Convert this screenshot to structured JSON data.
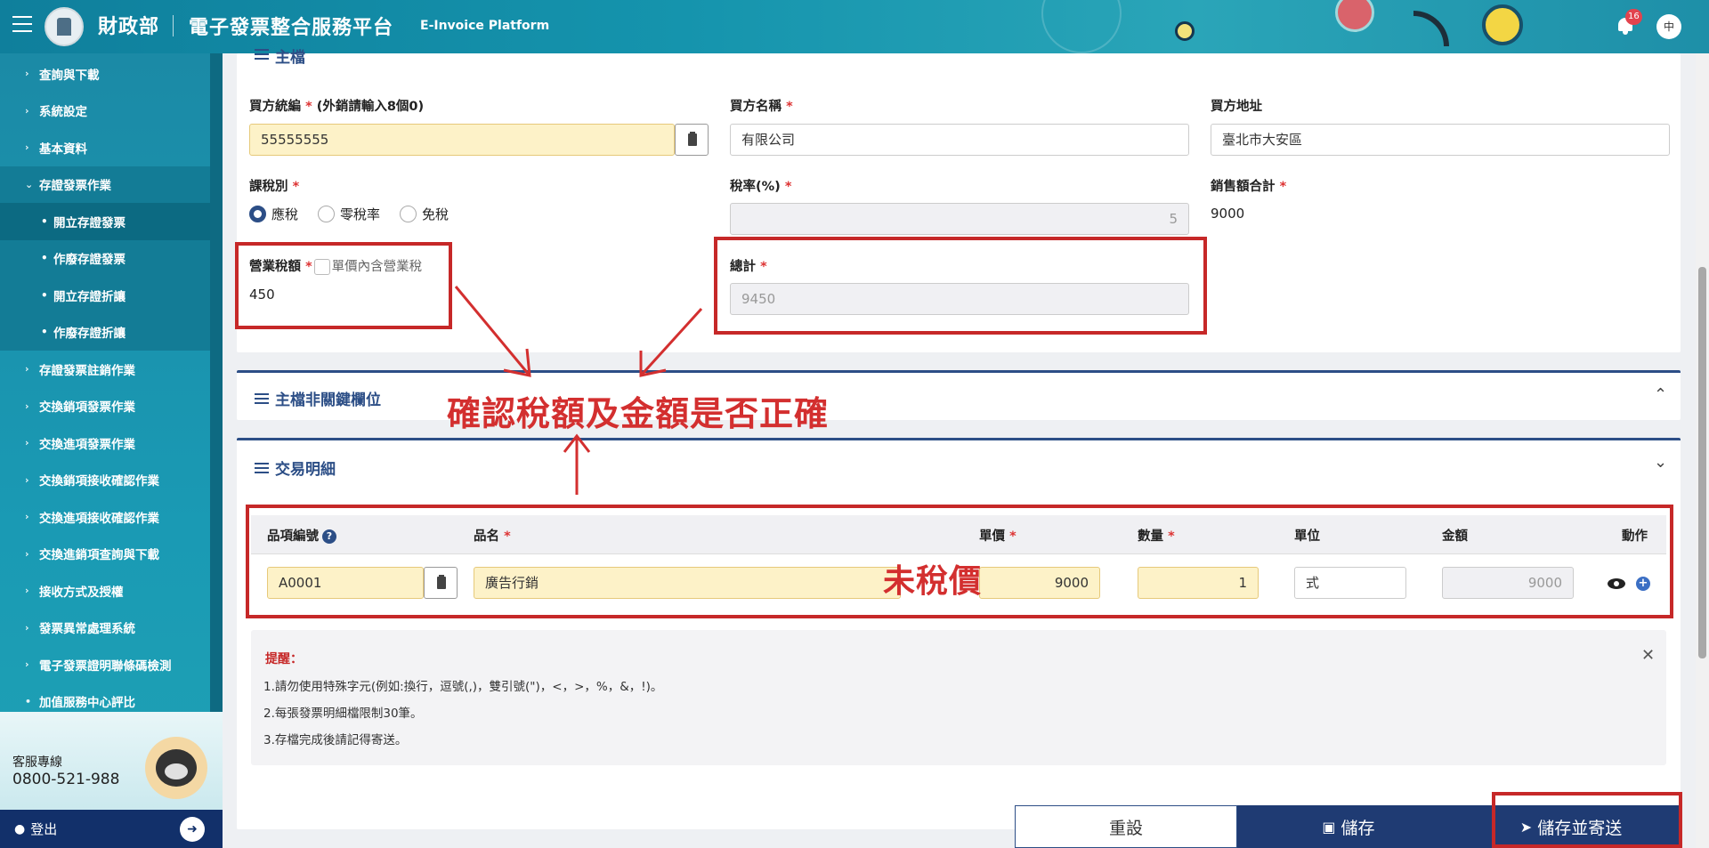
{
  "header": {
    "brand": "財政部",
    "platform": "電子發票整合服務平台",
    "platform_en": "E-Invoice Platform",
    "notification_count": "16",
    "language": "中"
  },
  "sidebar": {
    "items": [
      {
        "label": "查詢與下載",
        "type": "collapsed"
      },
      {
        "label": "系統設定",
        "type": "collapsed"
      },
      {
        "label": "基本資料",
        "type": "collapsed"
      },
      {
        "label": "存證發票作業",
        "type": "open"
      },
      {
        "label": "開立存證發票",
        "type": "sub-active"
      },
      {
        "label": "作廢存證發票",
        "type": "sub"
      },
      {
        "label": "開立存證折讓",
        "type": "sub"
      },
      {
        "label": "作廢存證折讓",
        "type": "sub"
      },
      {
        "label": "存證發票註銷作業",
        "type": "collapsed"
      },
      {
        "label": "交換銷項發票作業",
        "type": "collapsed"
      },
      {
        "label": "交換進項發票作業",
        "type": "collapsed"
      },
      {
        "label": "交換銷項接收確認作業",
        "type": "collapsed"
      },
      {
        "label": "交換進項接收確認作業",
        "type": "collapsed"
      },
      {
        "label": "交換進銷項查詢與下載",
        "type": "collapsed"
      },
      {
        "label": "接收方式及授權",
        "type": "collapsed"
      },
      {
        "label": "發票異常處理系統",
        "type": "collapsed"
      },
      {
        "label": "電子發票證明聯條碼檢測",
        "type": "collapsed"
      },
      {
        "label": "加值服務中心評比",
        "type": "bullet"
      }
    ],
    "hotline_label": "客服專線",
    "hotline_number": "0800-521-988",
    "logout_label": "登出"
  },
  "main_form": {
    "section_title": "主檔",
    "buyer_id_label": "買方統編",
    "buyer_id_hint": "(外銷請輸入8個0)",
    "buyer_id_value": "55555555",
    "buyer_name_label": "買方名稱",
    "buyer_name_value": "有限公司",
    "buyer_address_label": "買方地址",
    "buyer_address_value": "臺北市大安區",
    "tax_type_label": "課稅別",
    "tax_type_options": [
      "應稅",
      "零稅率",
      "免稅"
    ],
    "tax_type_selected": "應稅",
    "tax_rate_label": "稅率(%)",
    "tax_rate_value": "5",
    "sales_total_label": "銷售額合計",
    "sales_total_value": "9000",
    "tax_amount_label": "營業稅額",
    "tax_included_label": "單價內含營業稅",
    "tax_amount_value": "450",
    "total_label": "總計",
    "total_value": "9450"
  },
  "nonkey_section": {
    "title": "主檔非關鍵欄位"
  },
  "detail_section": {
    "title": "交易明細",
    "columns": {
      "item_no": "品項編號",
      "name": "品名",
      "price": "單價",
      "qty": "數量",
      "unit": "單位",
      "amount": "金額",
      "action": "動作"
    },
    "row": {
      "item_no": "A0001",
      "name": "廣告行銷",
      "price": "9000",
      "qty": "1",
      "unit": "式",
      "amount": "9000"
    }
  },
  "notice": {
    "title": "提醒：",
    "lines": [
      "1.請勿使用特殊字元(例如:換行，逗號(,)，雙引號(\")，<，>，%，&，!)。",
      "2.每張發票明細檔限制30筆。",
      "3.存檔完成後請記得寄送。"
    ]
  },
  "annotations": {
    "check_text": "確認稅額及金額是否正確",
    "untaxed_text": "未稅價"
  },
  "buttons": {
    "reset": "重設",
    "save": "儲存",
    "save_send": "儲存並寄送"
  },
  "colors": {
    "primary": "#1f3b73",
    "accent_red": "#c62828",
    "highlight_yellow": "#fdf2c8"
  }
}
